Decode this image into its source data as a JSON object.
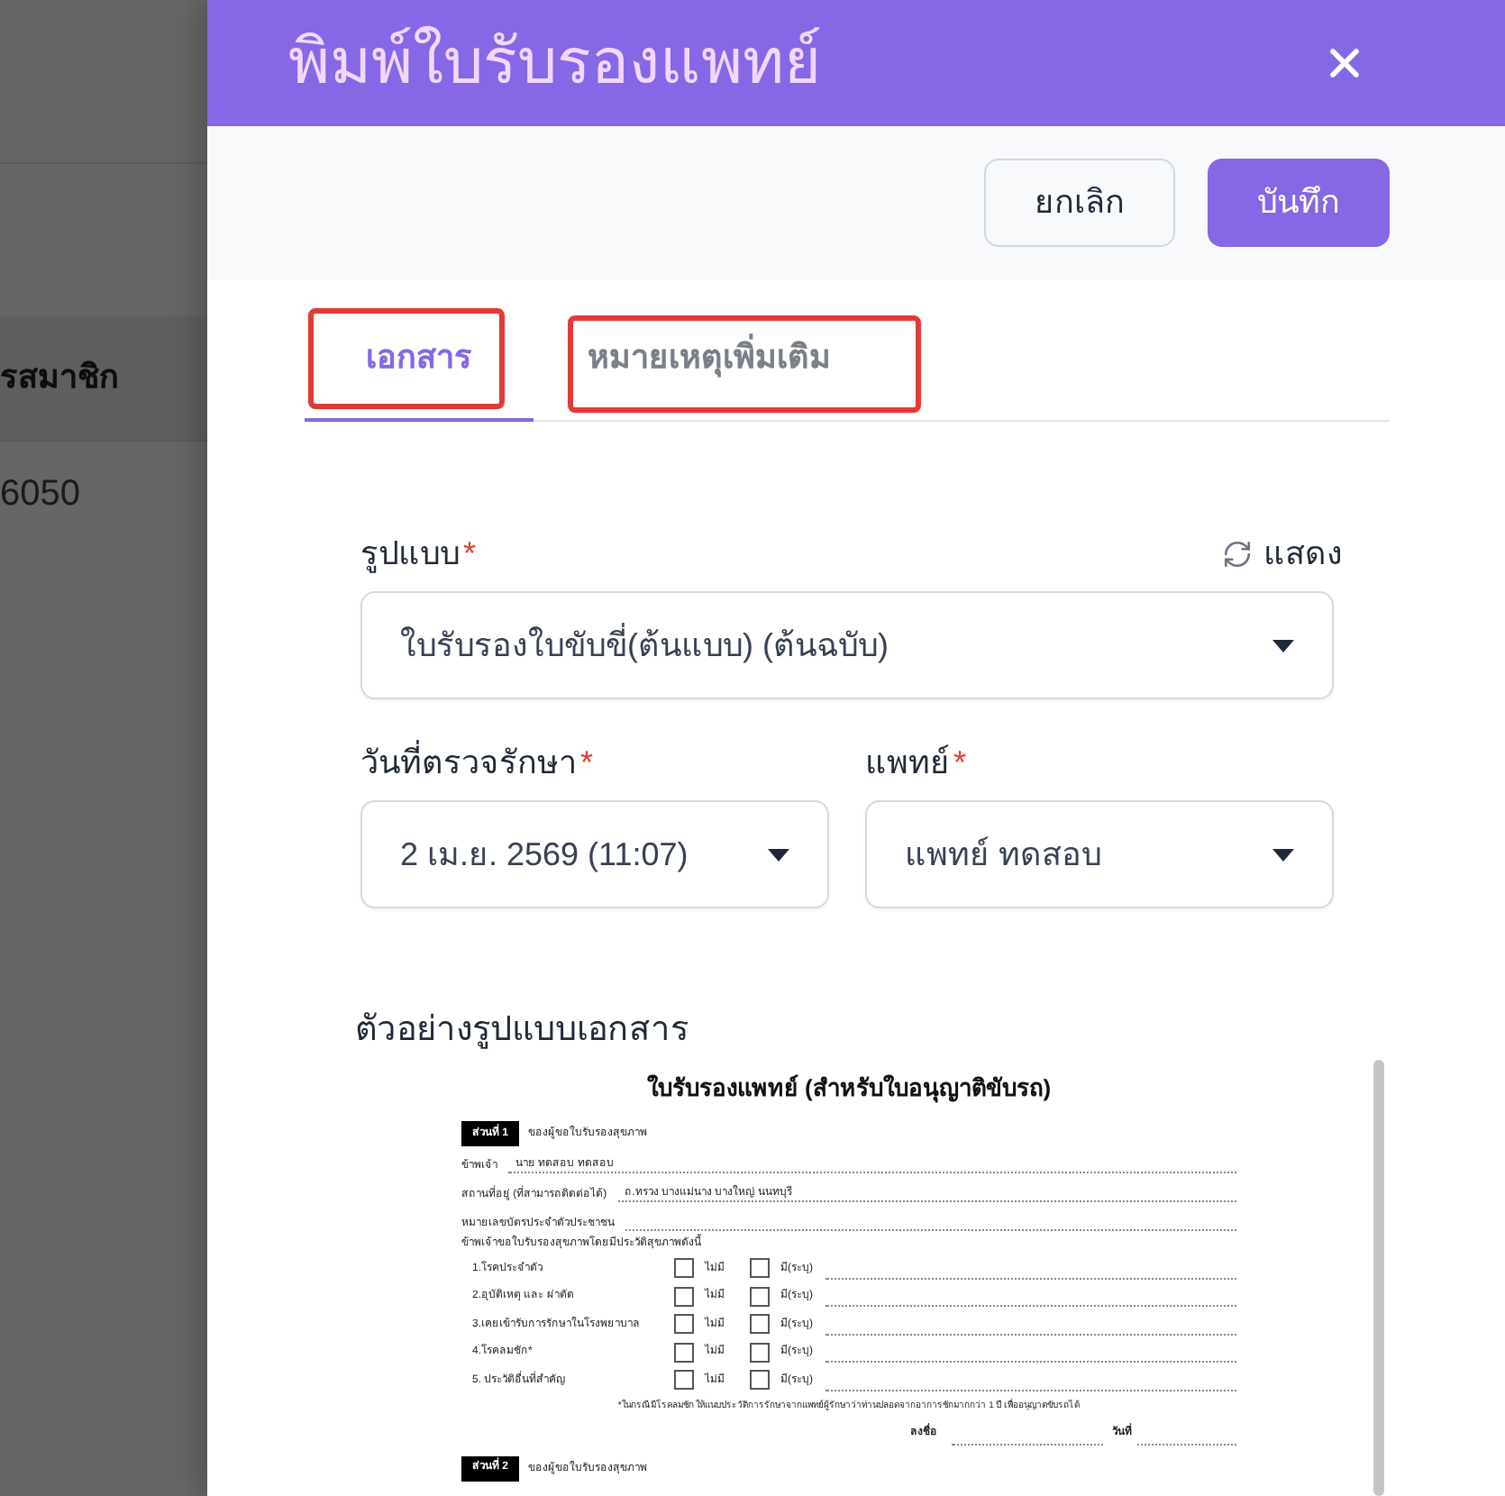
{
  "background_page": {
    "table_header": "รสมาชิก",
    "row_value": "6050"
  },
  "dialog": {
    "title": "พิมพ์ใบรับรองแพทย์",
    "actions": [
      {
        "kind": "secondary",
        "label": "ยกเลิก"
      },
      {
        "kind": "primary",
        "label": "บันทึก"
      }
    ],
    "tabs": [
      {
        "label": "เอกสาร",
        "selected": true,
        "highlighted": true
      },
      {
        "label": "หมายเหตุเพิ่มเติม",
        "selected": false,
        "highlighted": true
      }
    ],
    "form": {
      "format": {
        "label": "รูปแบบ",
        "required_mark": "*",
        "value": "ใบรับรองใบขับขี่(ต้นแบบ) (ต้นฉบับ)",
        "refresh_label": "แสดง"
      },
      "exam_date": {
        "label": "วันที่ตรวจรักษา",
        "required_mark": "*",
        "value": "2 เม.ย. 2569 (11:07)"
      },
      "doctor": {
        "label": "แพทย์",
        "required_mark": "*",
        "value": "แพทย์ ทดสอบ"
      }
    },
    "preview": {
      "heading": "ตัวอย่างรูปแบบเอกสาร",
      "document": {
        "title": "ใบรับรองแพทย์ (สำหรับใบอนุญาติขับรถ)",
        "parts": [
          {
            "badge": "ส่วนที่ 1",
            "heading": "ของผู้ขอใบรับรองสุขภาพ",
            "fields": [
              {
                "label": "ข้าพเจ้า",
                "value": "นาย ทดสอบ ทดสอบ"
              },
              {
                "label": "สถานที่อยู่ (ที่สามารถติดต่อได้)",
                "value": "ถ.ทรวง บางแม่นาง บางใหญ่ นนทบุรี"
              },
              {
                "label": "หมายเลขบัตรประจำตัวประชาชน"
              }
            ],
            "history_intro": "ข้าพเจ้าขอใบรับรองสุขภาพโดยมีประวัติสุขภาพดังนี้",
            "history": [
              {
                "label": "1.โรคประจำตัว",
                "options": [
                  {
                    "label": "ไม่มี",
                    "checked": false
                  },
                  {
                    "label": "มี(ระบุ)",
                    "checked": false
                  }
                ]
              },
              {
                "label": "2.อุบัติเหตุ และ ผ่าตัด",
                "options": [
                  {
                    "label": "ไม่มี",
                    "checked": false
                  },
                  {
                    "label": "มี(ระบุ)",
                    "checked": false
                  }
                ]
              },
              {
                "label": "3.เคยเข้ารับการรักษาในโรงพยาบาล",
                "options": [
                  {
                    "label": "ไม่มี",
                    "checked": false
                  },
                  {
                    "label": "มี(ระบุ)",
                    "checked": false
                  }
                ]
              },
              {
                "label": "4.โรคลมชัก*",
                "options": [
                  {
                    "label": "ไม่มี",
                    "checked": false
                  },
                  {
                    "label": "มี(ระบุ)",
                    "checked": false
                  }
                ]
              },
              {
                "label": "5. ประวัติอื่นที่สำคัญ",
                "options": [
                  {
                    "label": "ไม่มี",
                    "checked": false
                  },
                  {
                    "label": "มี(ระบุ)",
                    "checked": false
                  }
                ]
              }
            ],
            "footnote": "*ในกรณีมีโรคลมชัก ให้แนบประวัติการรักษาจากแพทย์ผู้รักษาว่าท่านปลอดจากอาการชักมากกว่า 1 ปี เพื่ออนุญาตขับรถได้",
            "signature": {
              "label": "ลงชื่อ",
              "date_label": "วันที่"
            }
          },
          {
            "badge": "ส่วนที่ 2",
            "heading": "ของผู้ขอใบรับรองสุขภาพ"
          }
        ]
      }
    }
  }
}
